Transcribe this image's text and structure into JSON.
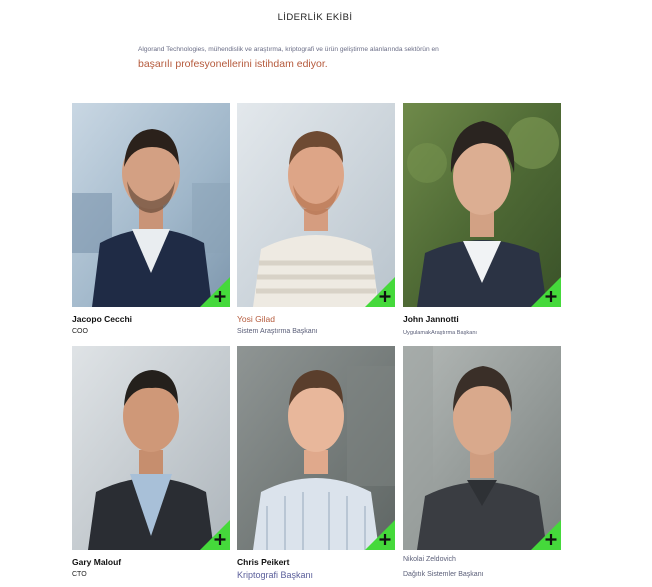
{
  "section": {
    "title": "LİDERLİK EKİBİ",
    "intro_small": "Algorand Technologies, mühendislik ve araştırma, kriptografi ve ürün geliştirme alanlarında sektörün en",
    "intro_large": "başarılı profesyonellerini istihdam ediyor."
  },
  "team": [
    {
      "name": "Jacopo Cecchi",
      "role": "COO",
      "icon": "plus-icon"
    },
    {
      "name": "Yosi Gilad",
      "role": "Sistem Araştırma Başkanı",
      "icon": "plus-icon"
    },
    {
      "name": "John Jannotti",
      "role": "UygulamakAraştırma Başkanı",
      "icon": "plus-icon"
    },
    {
      "name": "Gary Malouf",
      "role": "CTO",
      "icon": "plus-icon"
    },
    {
      "name": "Chris Peikert",
      "role": "Kriptografi Başkanı",
      "icon": "plus-icon"
    },
    {
      "name": "Nikolai Zeldovich",
      "role": "Dağıtık Sistemler Başkanı",
      "icon": "plus-icon"
    }
  ],
  "colors": {
    "accent_green": "#45d93b",
    "accent_text": "#b55a3c",
    "muted_text": "#6a6d86"
  }
}
